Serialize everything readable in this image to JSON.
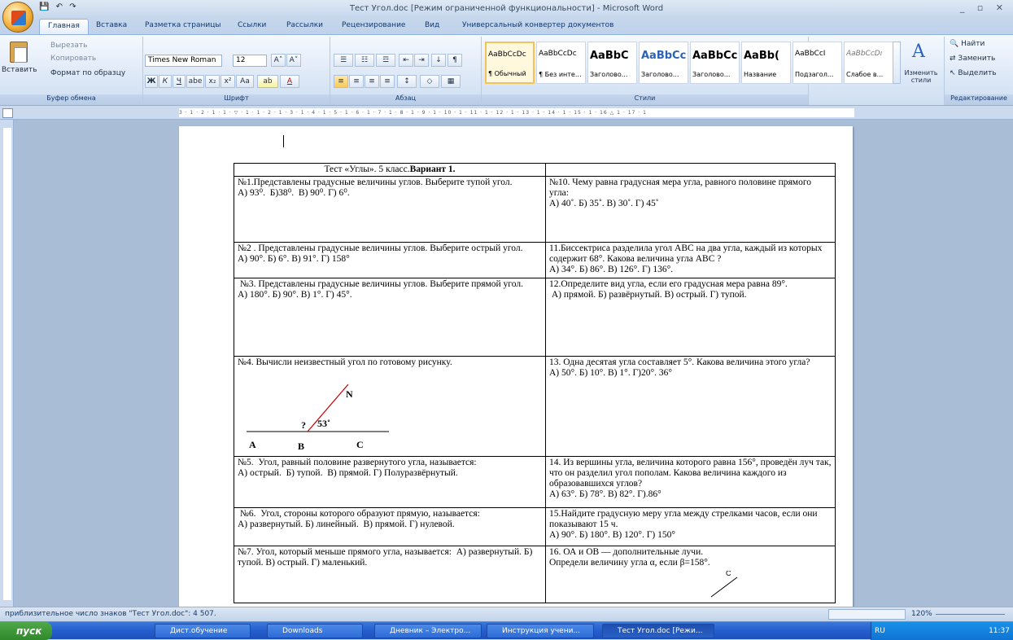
{
  "window": {
    "title": "Тест Угол.doc [Режим ограниченной функциональности] - Microsoft Word",
    "controls": "_ ▫ ✕"
  },
  "qat": {
    "save": "💾",
    "undo": "↶",
    "redo": "↷"
  },
  "tabs": [
    "Главная",
    "Вставка",
    "Разметка страницы",
    "Ссылки",
    "Рассылки",
    "Рецензирование",
    "Вид",
    "Универсальный конвертер документов"
  ],
  "ribbon": {
    "clipboard": {
      "paste": "Вставить",
      "cut": "Вырезать",
      "copy": "Копировать",
      "format_painter": "Формат по образцу",
      "label": "Буфер обмена"
    },
    "font": {
      "name": "Times New Roman",
      "size": "12",
      "label": "Шрифт",
      "bold": "Ж",
      "italic": "К",
      "underline": "Ч",
      "strike": "abe",
      "sub": "x₂",
      "sup": "x²",
      "case": "Aa",
      "grow": "A˄",
      "shrink": "A˅",
      "highlight": "ab",
      "color": "A"
    },
    "paragraph": {
      "label": "Абзац"
    },
    "styles": {
      "label": "Стили",
      "items": [
        {
          "sample": "AaBbCcDc",
          "name": "¶ Обычный"
        },
        {
          "sample": "AaBbCcDc",
          "name": "¶ Без инте..."
        },
        {
          "sample": "AaBbC",
          "name": "Заголово..."
        },
        {
          "sample": "AaBbCc",
          "name": "Заголово..."
        },
        {
          "sample": "AaBbCc",
          "name": "Заголово..."
        },
        {
          "sample": "AaBb(",
          "name": "Название"
        },
        {
          "sample": "AaBbCcI",
          "name": "Подзагол..."
        },
        {
          "sample": "AaBbCcDı",
          "name": "Слабое в..."
        }
      ],
      "change": "Изменить стили"
    },
    "editing": {
      "find": "Найти",
      "replace": "Заменить",
      "select": "Выделить",
      "label": "Редактирование"
    }
  },
  "ruler_text": "3 · 1 · 2 · 1 · 1 · ▽ · 1 · 1 · 2 · 1 · 3 · 1 · 4 · 1 · 5 · 1 · 6 · 1 · 7 · 1 · 8 · 1 · 9 · 1 · 10 · 1 · 11 · 1 · 12 · 1 · 13 · 1 · 14 · 1 · 15 · 1 · 16 △ 1 · 17 · 1",
  "doc": {
    "title_plain": "Тест «Углы». 5 класс.",
    "title_bold": "Вариант 1.",
    "rows": [
      [
        "№1.Представлены градусные величины углов. Выберите тупой угол.\nА) 93⁰.  Б)38⁰.  В) 90⁰. Г) 6⁰.",
        "№10. Чему равна градусная мера угла, равного половине прямого угла:\nА) 40˚. Б) 35˚. В) 30˚. Г) 45˚"
      ],
      [
        "№2 . Представлены градусные величины углов. Выберите острый угол.\nА) 90°. Б) 6°. В) 91°. Г) 158°",
        "11.Биссектриса разделила угол АВС на два угла, каждый из которых содержит 68°. Какова величина угла АВС ?\nА) 34°. Б) 86°. В) 126°. Г) 136°."
      ],
      [
        " №3. Представлены градусные величины углов. Выберите прямой угол.\nА) 180°. Б) 90°. В) 1°. Г) 45°.",
        "12.Определите вид угла, если его градусная мера равна 89°.\n А) прямой. Б) развёрнутый. В) острый. Г) тупой."
      ],
      [
        "№4. Вычисли неизвестный угол по готовому рисунку.",
        "13. Одна десятая угла составляет 5°. Какова величина этого угла?\nА) 50°. Б) 10°. В) 1°. Г)20°. 36°"
      ],
      [
        "№5.  Угол, равный половине развернутого угла, называется:\nА) острый.  Б) тупой.  В) прямой. Г) Полуразвёрнутый.",
        "14. Из вершины угла, величина которого равна 156°, проведён луч так, что он разделил угол пополам. Какова величина каждого из образовавшихся углов?\nА) 63°. Б) 78°. В) 82°. Г).86°"
      ],
      [
        " №6.  Угол, стороны которого образуют прямую, называется:\nА) развернутый. Б) линейный.  В) прямой. Г) нулевой.",
        "15.Найдите градусную меру угла между стрелками часов, если они показывают 15 ч.\nА) 90°. Б) 180°. В) 120°. Г) 150°"
      ],
      [
        "№7. Угол, который меньше прямого угла, называется:  А) развернутый. Б) тупой. В) острый. Г) маленький.",
        "16. ОА и ОВ — дополнительные лучи.\nОпредели величину угла α, если β=158°."
      ]
    ],
    "figure": {
      "N": "N",
      "angle": "?",
      "value": "53˚",
      "A": "A",
      "B": "B",
      "C": "C"
    },
    "figure2": {
      "C": "C"
    }
  },
  "status": {
    "text": "приблизительное число знаков \"Тест Угол.doc\": 4 507.",
    "zoom": "120%"
  },
  "taskbar": {
    "start": "пуск",
    "items": [
      "Дист.обучение",
      "Downloads",
      "Дневник – Электро...",
      "Инструкция учени...",
      "Тест Угол.doc [Режи..."
    ],
    "lang": "RU",
    "time": "11:37"
  }
}
